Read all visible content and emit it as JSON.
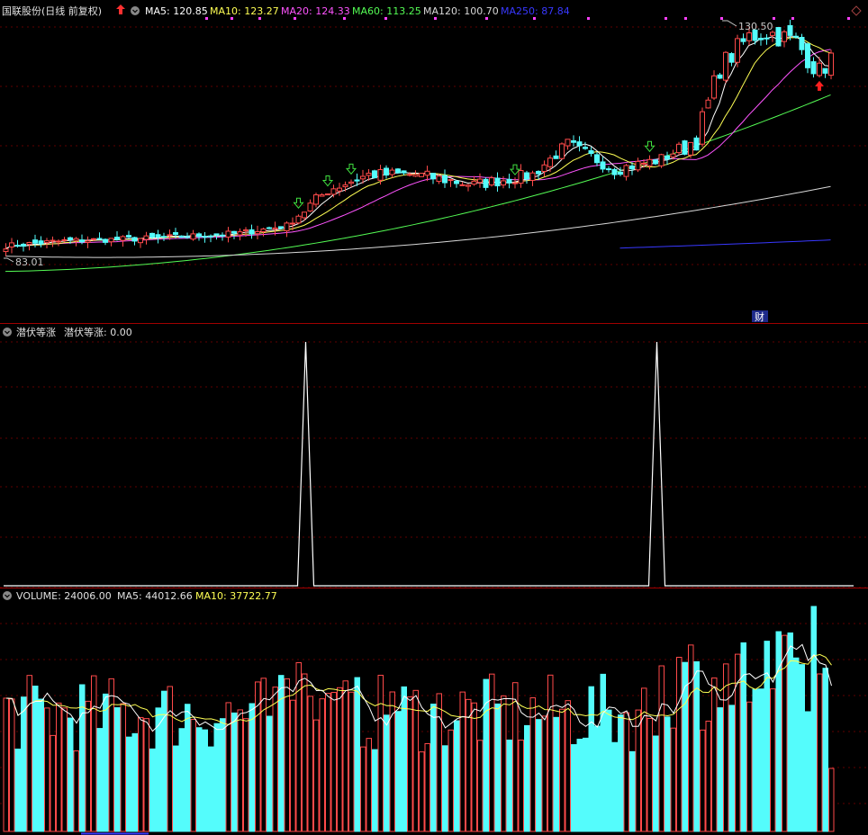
{
  "header": {
    "title": "国联股份(日线 前复权)",
    "ma5": "MA5: 120.85",
    "ma10": "MA10: 123.27",
    "ma20": "MA20: 124.33",
    "ma60": "MA60: 113.25",
    "ma120": "MA120: 100.70",
    "ma250": "MA250: 87.84"
  },
  "price_pane": {
    "high_label": "130.50",
    "low_label": "83.01",
    "finance_badge": "财"
  },
  "indicator_pane": {
    "title": "潜伏等涨",
    "value": "潜伏等涨: 0.00"
  },
  "volume_pane": {
    "volume": "VOLUME: 24006.00",
    "ma5": "MA5: 44012.66",
    "ma10": "MA10: 37722.77"
  },
  "colors": {
    "up": "#ff4a4a",
    "down": "#54fcfc",
    "ma5": "#ffffff",
    "ma10": "#ffff54",
    "ma20": "#ff54ff",
    "ma60": "#54fc54",
    "ma120": "#d8d8d8",
    "ma250": "#3838ff",
    "divider": "#a00000"
  },
  "icons": {
    "settings": "chevron-circle-icon",
    "trend_up": "red-up-arrow-icon",
    "buy_signal": "green-down-arrow-icon",
    "pane_toggle": "diamond-icon"
  },
  "chart_data": [
    {
      "type": "candlestick",
      "title": "国联股份(日线 前复权)",
      "ylim": [
        83,
        131
      ],
      "annotations": [
        "130.50",
        "83.01"
      ],
      "series": [
        {
          "name": "MA5",
          "last": 120.85
        },
        {
          "name": "MA10",
          "last": 123.27
        },
        {
          "name": "MA20",
          "last": 124.33
        },
        {
          "name": "MA60",
          "last": 113.25
        },
        {
          "name": "MA120",
          "last": 100.7
        },
        {
          "name": "MA250",
          "last": 87.84
        }
      ],
      "signals": {
        "green_down_arrows_at_bar": [
          50,
          55,
          59,
          87,
          110
        ],
        "red_up_arrow_at_bar": 139
      }
    },
    {
      "type": "line",
      "title": "潜伏等涨",
      "ylim": [
        0,
        1
      ],
      "spikes_at_bar": [
        51,
        111
      ],
      "current": 0.0
    },
    {
      "type": "bar",
      "title": "VOLUME",
      "series": [
        {
          "name": "VOLUME",
          "last": 24006.0
        },
        {
          "name": "MA5",
          "last": 44012.66
        },
        {
          "name": "MA10",
          "last": 37722.77
        }
      ]
    }
  ]
}
